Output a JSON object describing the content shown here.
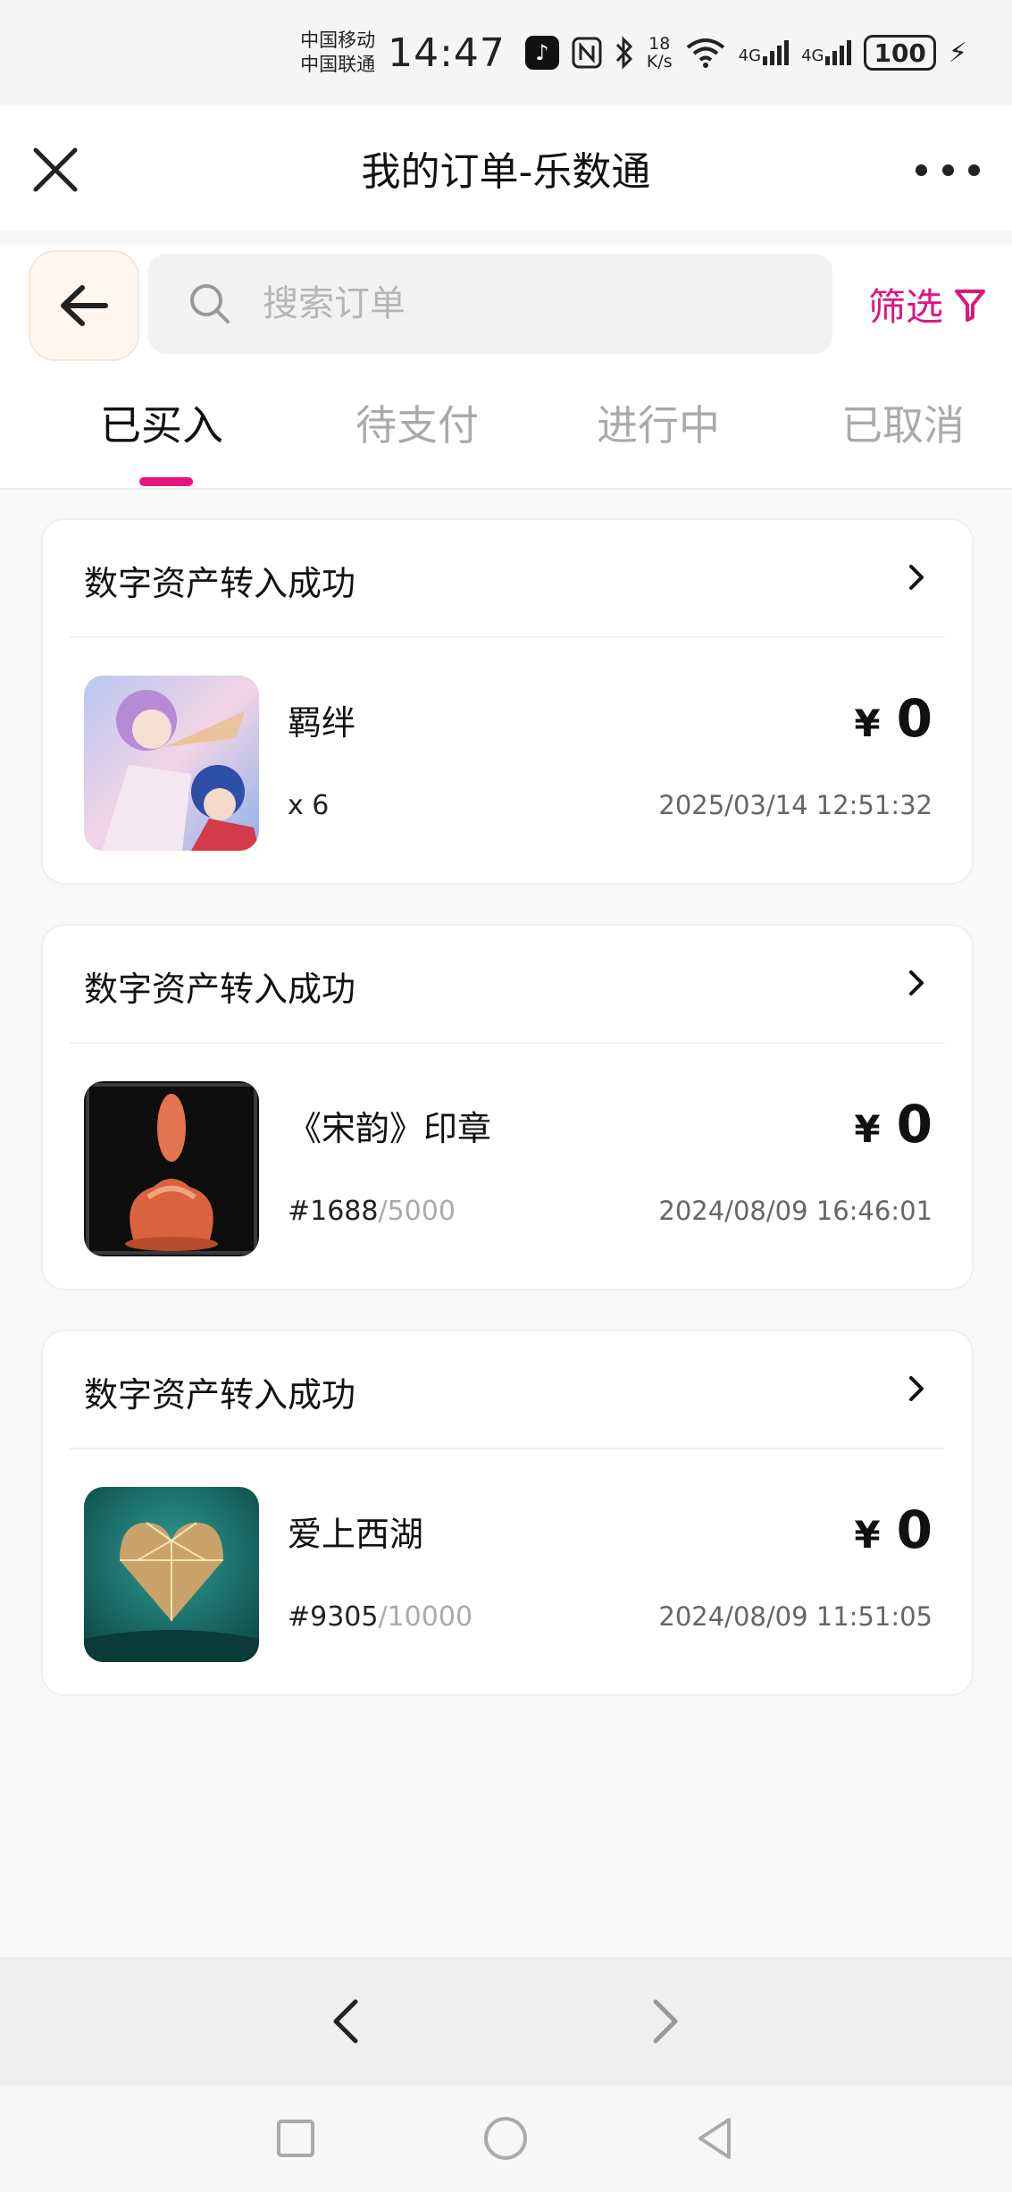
{
  "status_bar": {
    "carrier_1": "中国移动",
    "carrier_2": "中国联通",
    "time": "14:47",
    "net_speed_value": "18",
    "net_speed_unit": "K/s",
    "signal_1_label": "4G",
    "signal_2_label": "4G",
    "battery": "100"
  },
  "title_bar": {
    "title": "我的订单-乐数通"
  },
  "search": {
    "placeholder": "搜索订单",
    "filter_label": "筛选"
  },
  "tabs": [
    {
      "label": "已买入",
      "active": true
    },
    {
      "label": "待支付",
      "active": false
    },
    {
      "label": "进行中",
      "active": false
    },
    {
      "label": "已取消",
      "active": false
    }
  ],
  "orders": [
    {
      "status": "数字资产转入成功",
      "name": "羁绊",
      "meta_prefix": "x 6",
      "meta_total": "",
      "currency": "¥",
      "price": "0",
      "time": "2025/03/14 12:51:32"
    },
    {
      "status": "数字资产转入成功",
      "name": "《宋韵》印章",
      "meta_prefix": "#1688",
      "meta_total": "/5000",
      "currency": "¥",
      "price": "0",
      "time": "2024/08/09 16:46:01"
    },
    {
      "status": "数字资产转入成功",
      "name": "爱上西湖",
      "meta_prefix": "#9305",
      "meta_total": "/10000",
      "currency": "¥",
      "price": "0",
      "time": "2024/08/09 11:51:05"
    }
  ],
  "colors": {
    "accent": "#e5157f",
    "back_button_bg": "#fff7ef",
    "search_bg": "#f2f2f2"
  },
  "icons": {
    "close": "close-icon",
    "more": "more-icon",
    "back": "arrow-left-icon",
    "search": "search-icon",
    "filter": "filter-icon",
    "chevron": "chevron-right-icon"
  }
}
